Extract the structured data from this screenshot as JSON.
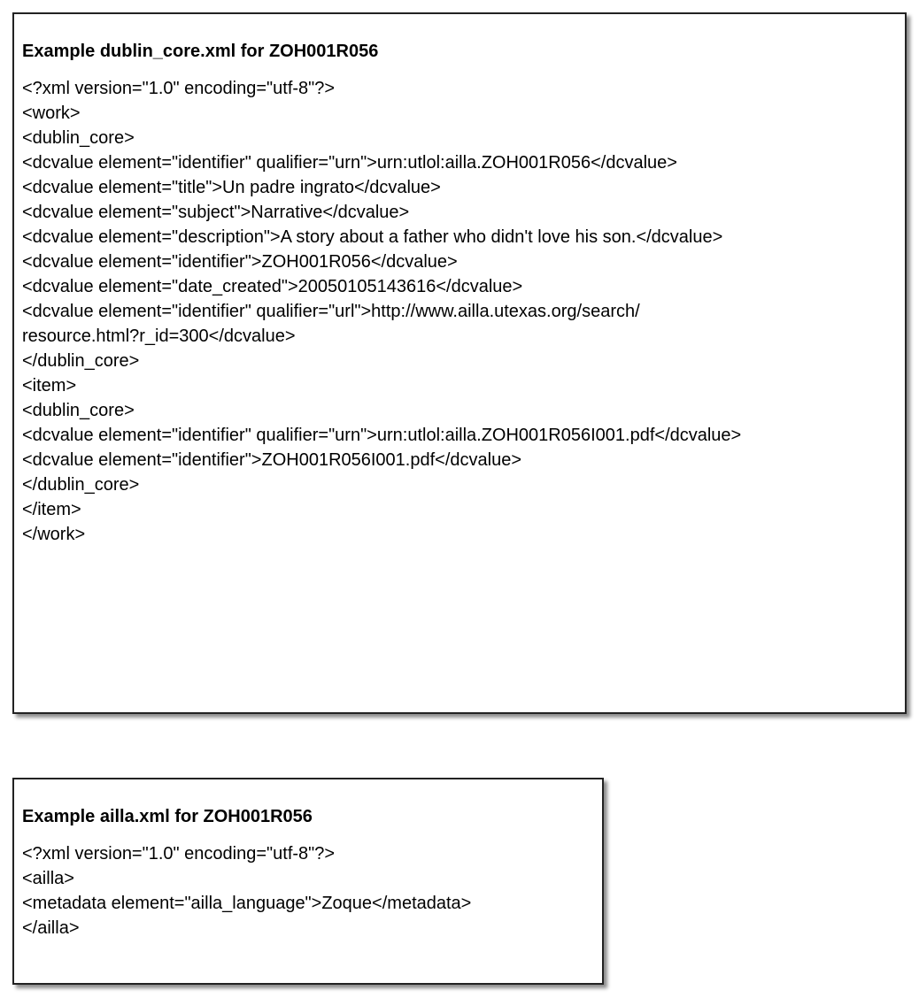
{
  "dublin_core_panel": {
    "title": "Example dublin_core.xml for ZOH001R056",
    "lines": [
      "<?xml version=\"1.0\" encoding=\"utf-8\"?>",
      "<work>",
      "<dublin_core>",
      "<dcvalue element=\"identifier\" qualifier=\"urn\">urn:utlol:ailla.ZOH001R056</dcvalue>",
      "<dcvalue element=\"title\">Un padre ingrato</dcvalue>",
      "<dcvalue element=\"subject\">Narrative</dcvalue>",
      "<dcvalue element=\"description\">A story about a father who didn't love his son.</dcvalue>",
      "<dcvalue element=\"identifier\">ZOH001R056</dcvalue>",
      "<dcvalue element=\"date_created\">20050105143616</dcvalue>",
      "<dcvalue element=\"identifier\" qualifier=\"url\">http://www.ailla.utexas.org/search/",
      "resource.html?r_id=300</dcvalue>",
      "</dublin_core>",
      "<item>",
      "<dublin_core>",
      "<dcvalue element=\"identifier\" qualifier=\"urn\">urn:utlol:ailla.ZOH001R056I001.pdf</dcvalue>",
      "<dcvalue element=\"identifier\">ZOH001R056I001.pdf</dcvalue>",
      "</dublin_core>",
      "</item>",
      "</work>"
    ]
  },
  "ailla_panel": {
    "title": "Example ailla.xml for ZOH001R056",
    "lines": [
      "<?xml version=\"1.0\" encoding=\"utf-8\"?>",
      "<ailla>",
      "<metadata element=\"ailla_language\">Zoque</metadata>",
      "</ailla>"
    ]
  }
}
